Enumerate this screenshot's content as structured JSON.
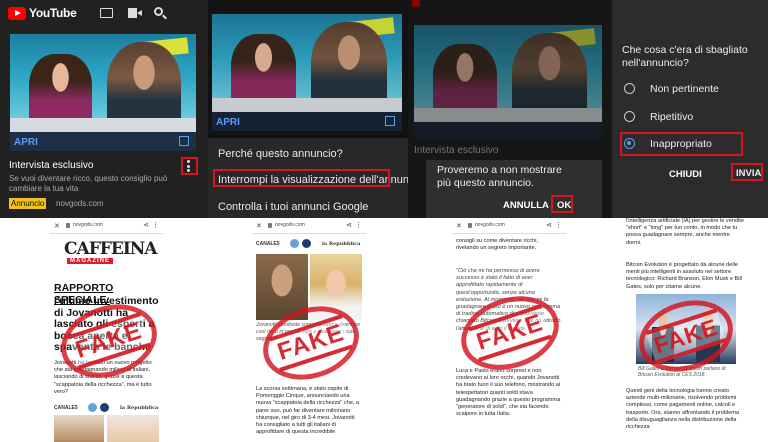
{
  "youtube": {
    "logo_text": "YouTube",
    "cast_icon": "cast-icon",
    "camera_icon": "camera-icon",
    "search_icon": "search-icon"
  },
  "panel1": {
    "apri": "APRI",
    "title": "Intervista esclusivo",
    "subtitle": "Se vuoi diventare ricco, questo consiglio può cambiare la tua vita",
    "badge": "Annuncio",
    "domain": "novgods.com"
  },
  "panel2": {
    "apri": "APRI",
    "menu": [
      "Perché questo annuncio?",
      "Interrompi la visualizzazione dell'annuncio",
      "Controlla i tuoi annunci Google"
    ]
  },
  "panel3": {
    "partial_title": "Intervista esclusivo",
    "dialog_text": "Proveremo a non mostrare più questo annuncio.",
    "cancel": "ANNULLA",
    "ok": "OK"
  },
  "panel4": {
    "question": "Che cosa c'era di sbagliato nell'annuncio?",
    "options": [
      "Non pertinente",
      "Ripetitivo",
      "Inappropriato"
    ],
    "selected": "Inappropriato",
    "close": "CHIUDI",
    "send": "INVIA"
  },
  "articles": {
    "url": "novgods.com",
    "stamp": "FAKE",
    "a1": {
      "logo_top": "CAFFEINA",
      "logo_bottom": "MAGAZINE",
      "headline_1": "RAPPORTO SPECIALE:",
      "headline_2": "l'ultimo investimento di Jovanotti ha lasciato gli esperti a bocca aperta e spaventa le banche",
      "body": "Jovanotti ha lanciato un nuovo progetto che sta guadagnando milioni di italiani, lasciando di stucco, grazie a questa \"scappatoia della ricchezza\", ma è tutto vero?",
      "logo_a": "CANALE5",
      "logo_b": "la Repubblica"
    },
    "a2": {
      "logo_a": "CANALE5",
      "logo_b": "la Repubblica",
      "caption": "Jovanotti condivide come ha fatto a diventare così ricco in poco tempo e quali sono i suoi segreti",
      "body": "La scorsa settimana, è stato ospite di Pomeriggio Cinque, annunciando una nuova \"scappatoia della ricchezza\" che, a parer suo, può far diventare milionario chiunque, nel giro di 3-4 mesi. Jovanotti ha consigliato a tutti gli italiani di approfittare di questa incredibile"
    },
    "a3": {
      "intro": "consigli su come diventare ricchi, rivelando un segreto importante.",
      "quote": "\"Ciò che mi ha permesso di avere successo è stato il fatto di aver approfittato rapidamente di quest'opportunità, senza alcuna esitazione. Al momento, ciò che mi fa guadagnare di più è un nuovo programma di trading automatico di criptovalute chiamato Bitcoin Evolution, che ha attratto l'attenzione di tutto il mondo.\"",
      "body": "Luca e Paolo erano sorpresi e non credevano ai loro occhi, quando Jovanotti ha tirato fuori il suo telefono, mostrando ai telespettatori quanti soldi stava guadagnando grazie a questo programma \"generatore di soldi\", che sta facendo scalpore in tutta Italia."
    },
    "a4": {
      "intro": "l'intelligenza artificiale (IA) per gestire le vendite \"short\" e \"long\" per tuo conto, in modo che tu possa guadagnare sempre, anche mentre dormi.",
      "body1": "Bitcoin Evolution è progettato da alcune delle menti più intelligenti in assoluto nel settore tecnologico: Richard Branson, Elon Musk e Bill Gates, solo per citarne alcune.",
      "caption": "Bill Gates e Richard Branson parlano di Bitcoin Evolution al CES 2018.",
      "body2": "Questi geni della tecnologia hanno creato aziende multi-milionarie, risolvendo problemi complessi, come pagamenti online, calcoli e trasporto. Ora, stanno affrontando il problema della disuguaglianza nella distribuzione della ricchezza"
    }
  }
}
